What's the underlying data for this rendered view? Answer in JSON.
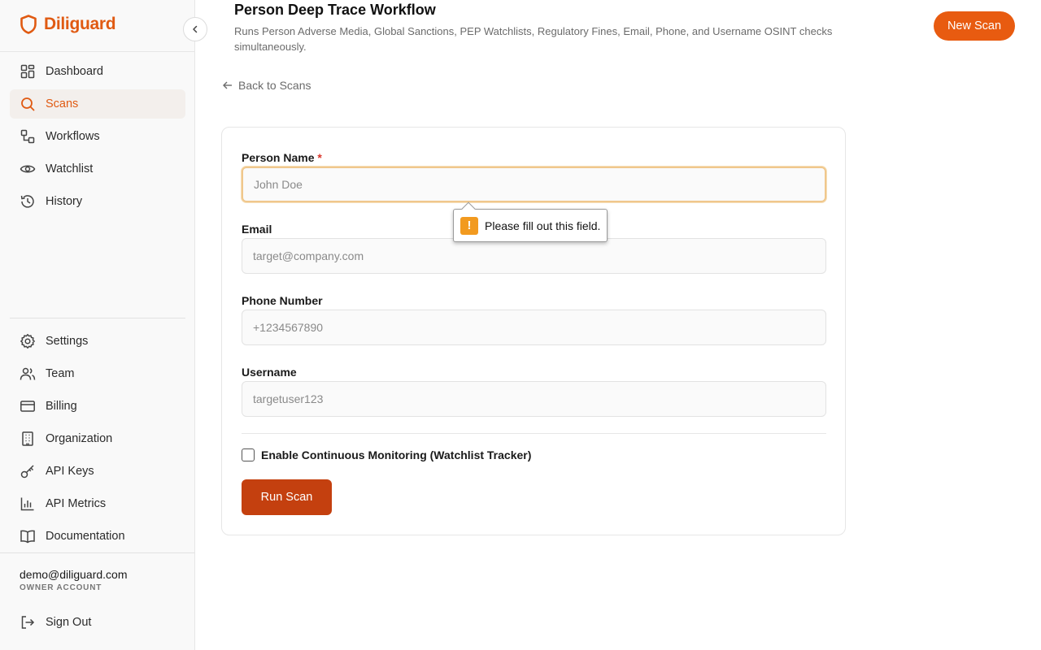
{
  "brand": {
    "name": "Diliguard",
    "accent": "#e05a12"
  },
  "sidebar": {
    "main_items": [
      {
        "label": "Dashboard",
        "icon": "dashboard-icon"
      },
      {
        "label": "Scans",
        "icon": "search-icon",
        "active": true
      },
      {
        "label": "Workflows",
        "icon": "workflow-icon"
      },
      {
        "label": "Watchlist",
        "icon": "eye-icon"
      },
      {
        "label": "History",
        "icon": "history-icon"
      }
    ],
    "bottom_items": [
      {
        "label": "Settings",
        "icon": "gear-icon"
      },
      {
        "label": "Team",
        "icon": "team-icon"
      },
      {
        "label": "Billing",
        "icon": "credit-card-icon"
      },
      {
        "label": "Organization",
        "icon": "building-icon"
      },
      {
        "label": "API Keys",
        "icon": "key-icon"
      },
      {
        "label": "API Metrics",
        "icon": "bar-chart-icon"
      },
      {
        "label": "Documentation",
        "icon": "book-icon"
      }
    ],
    "account": {
      "email": "demo@diliguard.com",
      "role": "OWNER ACCOUNT"
    },
    "signout_label": "Sign Out"
  },
  "header": {
    "title": "Person Deep Trace Workflow",
    "description": "Runs Person Adverse Media, Global Sanctions, PEP Watchlists, Regulatory Fines, Email, Phone, and Username OSINT checks simultaneously.",
    "new_scan_label": "New Scan"
  },
  "back_label": "Back to Scans",
  "form": {
    "person_name": {
      "label": "Person Name",
      "required_mark": "*",
      "placeholder": "John Doe",
      "value": ""
    },
    "email": {
      "label": "Email",
      "placeholder": "target@company.com",
      "value": ""
    },
    "phone": {
      "label": "Phone Number",
      "placeholder": "+1234567890",
      "value": ""
    },
    "username": {
      "label": "Username",
      "placeholder": "targetuser123",
      "value": ""
    },
    "monitoring_label": "Enable Continuous Monitoring (Watchlist Tracker)",
    "monitoring_checked": false,
    "submit_label": "Run Scan"
  },
  "validation_tooltip": "Please fill out this field."
}
